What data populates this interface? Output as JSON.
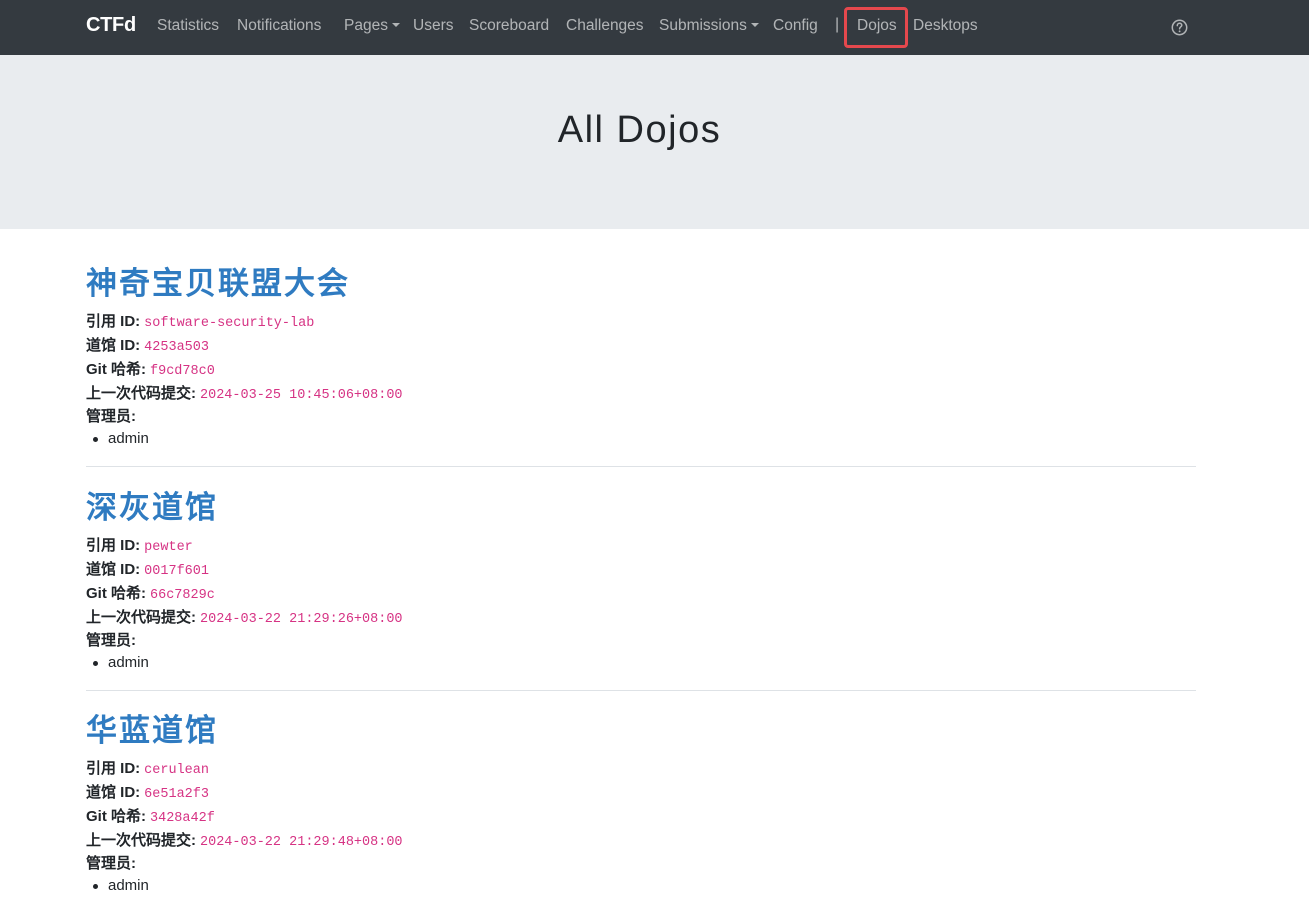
{
  "navbar": {
    "brand": "CTFd",
    "items": [
      {
        "label": "Statistics"
      },
      {
        "label": "Notifications"
      },
      {
        "label": "Pages"
      },
      {
        "label": "Users"
      },
      {
        "label": "Scoreboard"
      },
      {
        "label": "Challenges"
      },
      {
        "label": "Submissions"
      },
      {
        "label": "Config"
      },
      {
        "label": "Dojos"
      },
      {
        "label": "Desktops"
      }
    ],
    "separator": "|",
    "help_icon": "question-circle-icon",
    "highlight_color": "#e5484d"
  },
  "page": {
    "title": "All Dojos"
  },
  "labels": {
    "ref_id": "引用 ID:",
    "dojo_id": "道馆 ID:",
    "git_hash": "Git 哈希:",
    "last_commit": "上一次代码提交:",
    "admins": "管理员:"
  },
  "dojos": [
    {
      "name": "神奇宝贝联盟大会",
      "ref_id": "software-security-lab",
      "dojo_id": "4253a503",
      "git_hash": "f9cd78c0",
      "last_commit": "2024-03-25 10:45:06+08:00",
      "admins": [
        "admin"
      ]
    },
    {
      "name": "深灰道馆",
      "ref_id": "pewter",
      "dojo_id": "0017f601",
      "git_hash": "66c7829c",
      "last_commit": "2024-03-22 21:29:26+08:00",
      "admins": [
        "admin"
      ]
    },
    {
      "name": "华蓝道馆",
      "ref_id": "cerulean",
      "dojo_id": "6e51a2f3",
      "git_hash": "3428a42f",
      "last_commit": "2024-03-22 21:29:48+08:00",
      "admins": [
        "admin"
      ]
    }
  ],
  "colors": {
    "navbar_bg": "#343a40",
    "jumbotron_bg": "#e9ecef",
    "dojo_link": "#2f7bc1",
    "code_text": "#d63384"
  }
}
